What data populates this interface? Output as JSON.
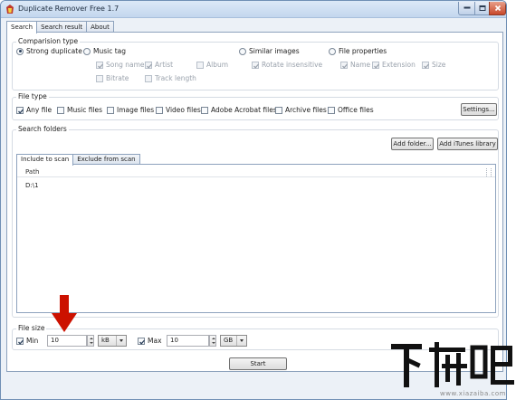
{
  "window": {
    "title": "Duplicate Remover Free 1.7"
  },
  "tabs": [
    {
      "label": "Search",
      "active": true
    },
    {
      "label": "Search result",
      "active": false
    },
    {
      "label": "About",
      "active": false
    }
  ],
  "comparison": {
    "title": "Comparision type",
    "strong_duplicate": "Strong duplicate",
    "music_tag": "Music tag",
    "similar_images": "Similar images",
    "file_properties": "File properties",
    "music_options": {
      "song_name": "Song name",
      "artist": "Artist",
      "album": "Album",
      "bitrate": "Bitrate",
      "track_length": "Track length"
    },
    "image_options": {
      "rotate_insensitive": "Rotate insensitive"
    },
    "file_options": {
      "name": "Name",
      "extension": "Extension",
      "size": "Size"
    }
  },
  "file_type": {
    "title": "File type",
    "items": [
      "Any file",
      "Music files",
      "Image files",
      "Video files",
      "Adobe Acrobat files",
      "Archive files",
      "Office files"
    ],
    "settings_button": "Settings..."
  },
  "search_folders": {
    "title": "Search folders",
    "add_folder_button": "Add folder...",
    "add_itunes_button": "Add iTunes library",
    "subtabs": [
      "Include to scan",
      "Exclude from scan"
    ],
    "column_path": "Path",
    "rows": [
      "D:\\1"
    ]
  },
  "file_size": {
    "title": "File size",
    "min_label": "Min",
    "min_value": "10",
    "min_unit": "kB",
    "max_label": "Max",
    "max_value": "10",
    "max_unit": "GB"
  },
  "start_button": "Start",
  "watermark": {
    "text": "下载吧",
    "url": "www.xiazaiba.com"
  },
  "colors": {
    "arrow": "#cc1100",
    "accent": "#2a3f5a"
  }
}
